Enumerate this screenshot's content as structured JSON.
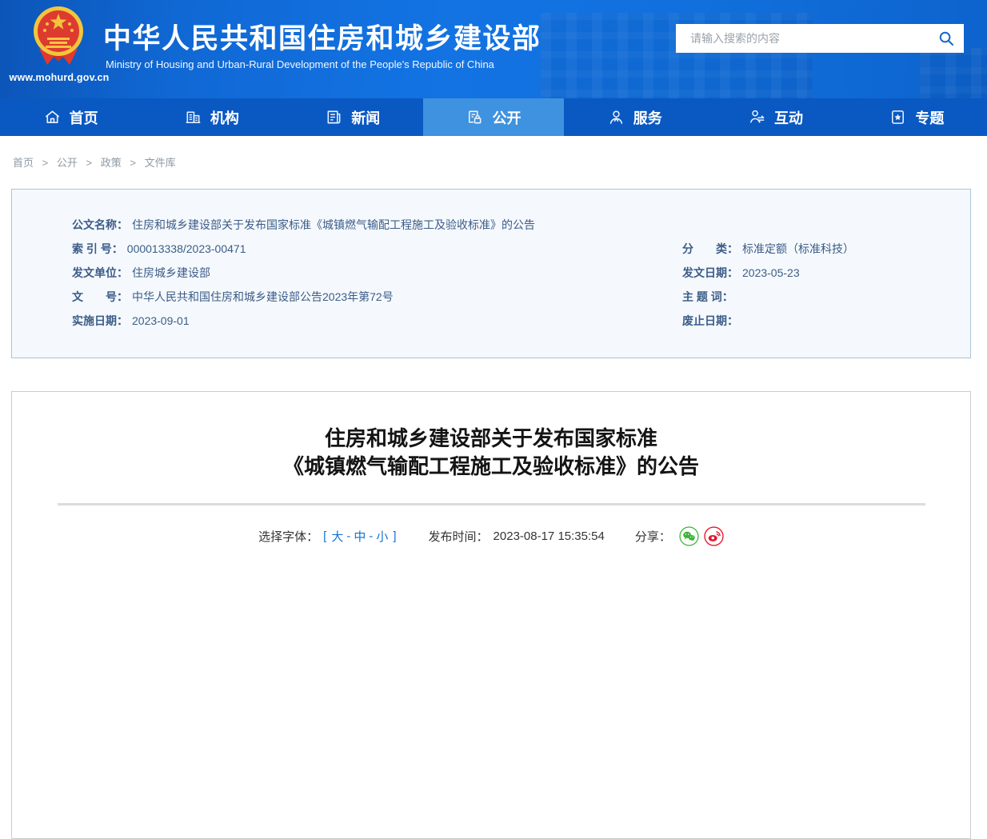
{
  "header": {
    "url": "www.mohurd.gov.cn",
    "title": "中华人民共和国住房和城乡建设部",
    "subtitle": "Ministry of Housing and Urban-Rural Development of the People's Republic of China",
    "search": {
      "placeholder": "请输入搜索的内容"
    }
  },
  "nav": {
    "items": [
      {
        "label": "首页",
        "icon": "home-icon",
        "active": false
      },
      {
        "label": "机构",
        "icon": "organization-icon",
        "active": false
      },
      {
        "label": "新闻",
        "icon": "news-icon",
        "active": false
      },
      {
        "label": "公开",
        "icon": "disclosure-icon",
        "active": true
      },
      {
        "label": "服务",
        "icon": "service-icon",
        "active": false
      },
      {
        "label": "互动",
        "icon": "interaction-icon",
        "active": false
      },
      {
        "label": "专题",
        "icon": "topics-icon",
        "active": false
      }
    ]
  },
  "breadcrumb": {
    "items": [
      "首页",
      "公开",
      "政策",
      "文件库"
    ],
    "separator": ">"
  },
  "doc_info": {
    "rows_left": [
      {
        "label": "公文名称：",
        "value": "住房和城乡建设部关于发布国家标准《城镇燃气输配工程施工及验收标准》的公告"
      },
      {
        "label": "索 引 号：",
        "value": "000013338/2023-00471"
      },
      {
        "label": "发文单位：",
        "value": "住房城乡建设部"
      },
      {
        "label": "文　　号：",
        "value": "中华人民共和国住房和城乡建设部公告2023年第72号"
      },
      {
        "label": "实施日期：",
        "value": "2023-09-01"
      }
    ],
    "rows_right": [
      {
        "label": "分　　类：",
        "value": "标准定额（标准科技）"
      },
      {
        "label": "发文日期：",
        "value": "2023-05-23"
      },
      {
        "label": "主 题 词：",
        "value": ""
      },
      {
        "label": "废止日期：",
        "value": ""
      }
    ]
  },
  "article": {
    "title_line1": "住房和城乡建设部关于发布国家标准",
    "title_line2": "《城镇燃气输配工程施工及验收标准》的公告",
    "font_label": "选择字体：",
    "bracket_open": "[",
    "bracket_close": "]",
    "dash": "-",
    "font_sizes": [
      "大",
      "中",
      "小"
    ],
    "publish_label": "发布时间：",
    "publish_time": "2023-08-17 15:35:54",
    "share_label": "分享：",
    "share_icons": [
      "wechat-share-icon",
      "weibo-share-icon"
    ]
  },
  "colors": {
    "header_blue": "#1170dd",
    "nav_blue": "#0a58c2",
    "nav_active_blue": "#3f92df",
    "link_blue": "#1472d6",
    "info_text_blue": "#3b5c88",
    "info_box_bg": "#f5f9fd",
    "info_box_border": "#a9c4da",
    "wechat_green": "#3db339",
    "weibo_red": "#e6162d"
  }
}
